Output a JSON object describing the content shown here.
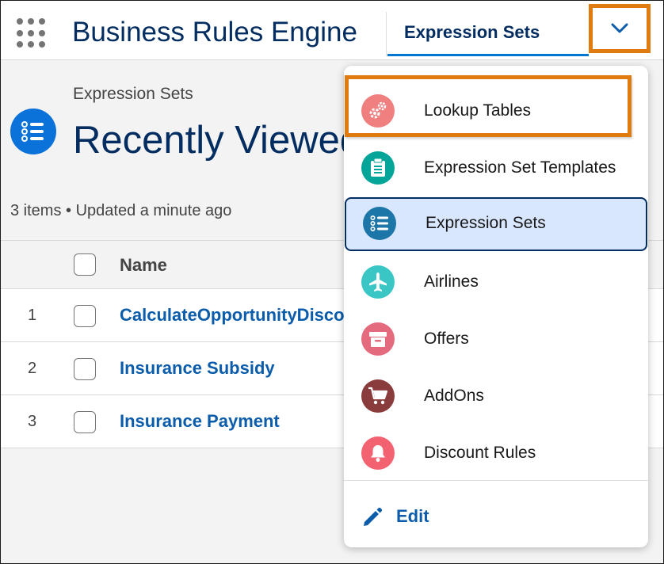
{
  "header": {
    "app_name": "Business Rules Engine",
    "active_tab": "Expression Sets",
    "waffle_icon": "app-launcher-icon",
    "dropdown_icon": "chevron-down-icon"
  },
  "list": {
    "eyebrow": "Expression Sets",
    "title": "Recently Viewed",
    "meta": "3 items • Updated a minute ago",
    "column_name": "Name",
    "rows": [
      {
        "num": "1",
        "name": "CalculateOpportunityDiscount"
      },
      {
        "num": "2",
        "name": "Insurance Subsidy"
      },
      {
        "num": "3",
        "name": "Insurance Payment"
      }
    ]
  },
  "menu": {
    "items": [
      {
        "label": "Lookup Tables",
        "icon": "gears-icon",
        "color": "#f07f7f"
      },
      {
        "label": "Expression Set Templates",
        "icon": "clipboard-icon",
        "color": "#06a59a"
      },
      {
        "label": "Expression Sets",
        "icon": "list-icon",
        "color": "#1d76a8"
      },
      {
        "label": "Airlines",
        "icon": "airplane-icon",
        "color": "#3bc6c6"
      },
      {
        "label": "Offers",
        "icon": "archive-box-icon",
        "color": "#e46a7e"
      },
      {
        "label": "AddOns",
        "icon": "cart-icon",
        "color": "#8a3c3c"
      },
      {
        "label": "Discount Rules",
        "icon": "bell-icon",
        "color": "#f26271"
      }
    ],
    "edit_label": "Edit",
    "edit_icon": "pencil-icon"
  },
  "colors": {
    "accent": "#0176d3",
    "highlight": "#e07b10",
    "brand_dark": "#032d60",
    "link": "#0b5cab"
  }
}
